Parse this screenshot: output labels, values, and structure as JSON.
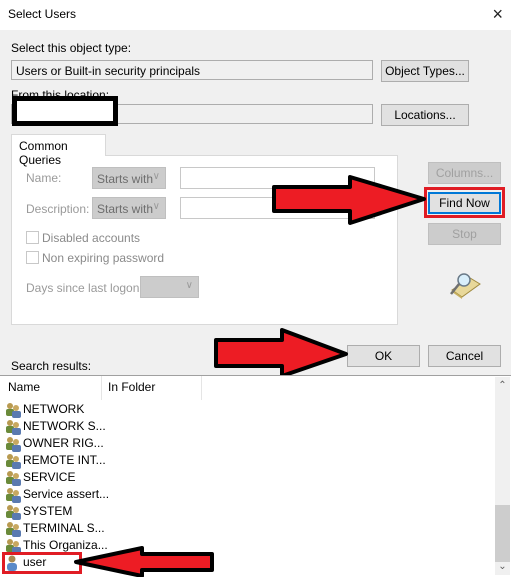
{
  "window": {
    "title": "Select Users",
    "close_icon": "×"
  },
  "object_type": {
    "label": "Select this object type:",
    "value": "Users or Built-in security principals",
    "button": "Object Types..."
  },
  "location": {
    "label": "From this location:",
    "value": "",
    "button": "Locations..."
  },
  "queries": {
    "tab": "Common Queries",
    "name_label": "Name:",
    "name_mode": "Starts with",
    "name_value": "",
    "description_label": "Description:",
    "description_mode": "Starts with",
    "description_value": "",
    "disabled_accounts": {
      "label": "Disabled accounts",
      "checked": false
    },
    "non_expiring_password": {
      "label": "Non expiring password",
      "checked": false
    },
    "days_label": "Days since last logon:",
    "days_value": ""
  },
  "buttons": {
    "columns": "Columns...",
    "find_now": "Find Now",
    "stop": "Stop",
    "ok": "OK",
    "cancel": "Cancel"
  },
  "results": {
    "label": "Search results:",
    "columns": [
      "Name",
      "In Folder"
    ],
    "rows": [
      {
        "name": "NETWORK",
        "folder": "",
        "icon": "group-icon"
      },
      {
        "name": "NETWORK S...",
        "folder": "",
        "icon": "group-icon"
      },
      {
        "name": "OWNER RIG...",
        "folder": "",
        "icon": "group-icon"
      },
      {
        "name": "REMOTE INT...",
        "folder": "",
        "icon": "group-icon"
      },
      {
        "name": "SERVICE",
        "folder": "",
        "icon": "group-icon"
      },
      {
        "name": "Service assert...",
        "folder": "",
        "icon": "group-icon"
      },
      {
        "name": "SYSTEM",
        "folder": "",
        "icon": "group-icon"
      },
      {
        "name": "TERMINAL S...",
        "folder": "",
        "icon": "group-icon"
      },
      {
        "name": "This Organiza...",
        "folder": "",
        "icon": "group-icon"
      },
      {
        "name": "user",
        "folder": "",
        "icon": "user-icon"
      }
    ],
    "scroll_position": 0.85
  },
  "annotations": {
    "highlight_color": "#e01c24",
    "arrow_fill": "#ed1c24"
  }
}
